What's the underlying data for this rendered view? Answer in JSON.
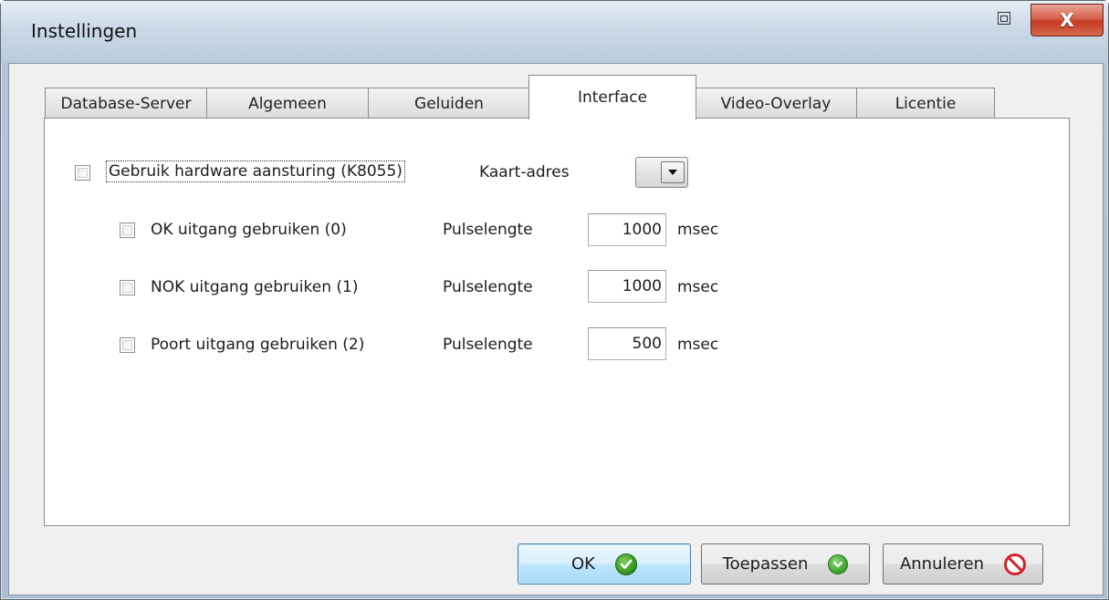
{
  "window": {
    "title": "Instellingen",
    "close_label": "X"
  },
  "tabs": [
    {
      "label": "Database-Server",
      "active": false
    },
    {
      "label": "Algemeen",
      "active": false
    },
    {
      "label": "Geluiden",
      "active": false
    },
    {
      "label": "Interface",
      "active": true
    },
    {
      "label": "Video-Overlay",
      "active": false
    },
    {
      "label": "Licentie",
      "active": false
    }
  ],
  "interface": {
    "use_hardware": {
      "label": "Gebruik hardware aansturing (K8055)",
      "checked": false
    },
    "card_address": {
      "label": "Kaart-adres",
      "value": ""
    },
    "outputs": [
      {
        "label": "OK uitgang gebruiken (0)",
        "checked": false,
        "pulse_label": "Pulselengte",
        "pulse_value": "1000",
        "unit": "msec"
      },
      {
        "label": "NOK uitgang gebruiken (1)",
        "checked": false,
        "pulse_label": "Pulselengte",
        "pulse_value": "1000",
        "unit": "msec"
      },
      {
        "label": "Poort uitgang gebruiken (2)",
        "checked": false,
        "pulse_label": "Pulselengte",
        "pulse_value": "500",
        "unit": "msec"
      }
    ]
  },
  "buttons": {
    "ok": {
      "label": "OK",
      "icon": "check-icon"
    },
    "apply": {
      "label": "Toepassen",
      "icon": "apply-icon"
    },
    "cancel": {
      "label": "Annuleren",
      "icon": "cancel-icon"
    }
  },
  "colors": {
    "default_button_border": "#3c7fb1",
    "close_button": "#c43b22",
    "ok_icon": "#2c8f1a",
    "cancel_icon": "#d1242a"
  }
}
